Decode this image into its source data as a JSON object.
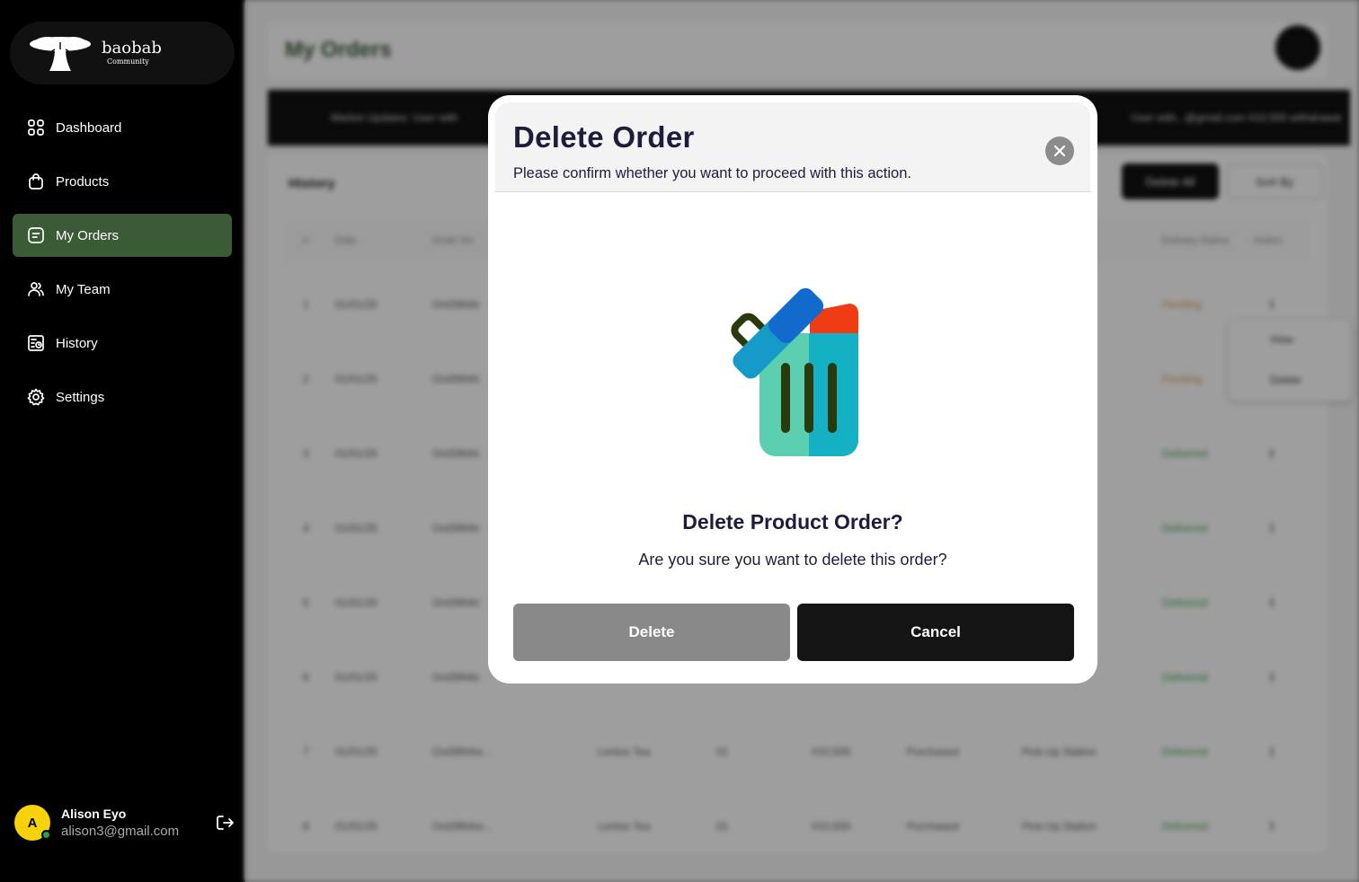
{
  "brand": {
    "name": "baobab",
    "sub": "Community"
  },
  "nav": {
    "items": [
      {
        "label": "Dashboard",
        "icon": "grid-icon"
      },
      {
        "label": "Products",
        "icon": "bag-icon"
      },
      {
        "label": "My Orders",
        "icon": "orders-icon"
      },
      {
        "label": "My Team",
        "icon": "team-icon"
      },
      {
        "label": "History",
        "icon": "history-icon"
      },
      {
        "label": "Settings",
        "icon": "gear-icon"
      }
    ],
    "active": "My Orders"
  },
  "user": {
    "initial": "A",
    "name": "Alison Eyo",
    "email": "alison3@gmail.com"
  },
  "background": {
    "page_title": "My Orders",
    "ticker_left": "Market Updates: User with",
    "ticker_right": "User with...@gmail.com #10,500 withdrawal",
    "history_title": "History",
    "delete_all": "Delete All",
    "sort_by": "Sort By",
    "columns": [
      "#",
      "Date",
      "Order No.",
      "Delivery Status",
      "Action"
    ],
    "rows": [
      {
        "n": "1",
        "date": "01/01/25",
        "order": "Ord39hihi",
        "status": "Pending"
      },
      {
        "n": "2",
        "date": "01/01/25",
        "order": "Ord39hihi",
        "status": "Pending"
      },
      {
        "n": "3",
        "date": "01/01/25",
        "order": "Ord39hihi",
        "status": "Delivered"
      },
      {
        "n": "4",
        "date": "01/01/25",
        "order": "Ord39hihi",
        "status": "Delivered"
      },
      {
        "n": "5",
        "date": "01/01/25",
        "order": "Ord39hihi",
        "status": "Delivered"
      },
      {
        "n": "6",
        "date": "01/01/25",
        "order": "Ord39hihi",
        "status": "Delivered"
      },
      {
        "n": "7",
        "date": "01/01/25",
        "order": "Ord39hihe...",
        "product": "Lentox Tea",
        "qty": "01",
        "price": "#10,500",
        "type": "Purchased",
        "delivery": "Pick-Up Station",
        "status": "Delivered"
      },
      {
        "n": "8",
        "date": "01/01/25",
        "order": "Ord39hihe...",
        "product": "Lentox Tea",
        "qty": "01",
        "price": "#10,500",
        "type": "Purchased",
        "delivery": "Pick-Up Station",
        "status": "Delivered"
      }
    ],
    "action_menu": [
      "View",
      "Delete"
    ]
  },
  "modal": {
    "title": "Delete Order",
    "subtitle": "Please confirm whether you want to proceed with this action.",
    "confirm_title": "Delete Product Order?",
    "confirm_text": "Are you sure you want to delete this order?",
    "delete_label": "Delete",
    "cancel_label": "Cancel"
  },
  "colors": {
    "sidebar": "#000000",
    "active_nav": "#3b5b37",
    "modal_bg": "#ffffff",
    "delete_btn": "#898989",
    "cancel_btn": "#141414",
    "avatar": "#f7d20a"
  }
}
